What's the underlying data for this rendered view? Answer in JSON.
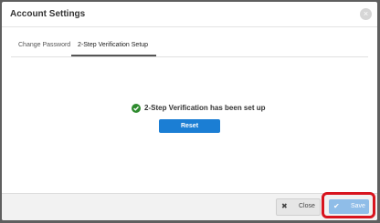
{
  "dialog": {
    "title": "Account Settings",
    "close_icon": "×"
  },
  "tabs": [
    {
      "label": "Change Password",
      "active": false
    },
    {
      "label": "2-Step Verification Setup",
      "active": true
    }
  ],
  "status": {
    "message": "2-Step Verification has been set up",
    "icon": "check-circle-icon",
    "color": "#2e8b2e"
  },
  "reset_button": {
    "label": "Reset"
  },
  "footer": {
    "close_label": "Close",
    "close_icon": "✖",
    "save_label": "Save",
    "save_icon": "✔"
  },
  "colors": {
    "primary": "#1b7ed4",
    "save_disabled": "#8fbde8",
    "highlight": "#d8141e"
  }
}
